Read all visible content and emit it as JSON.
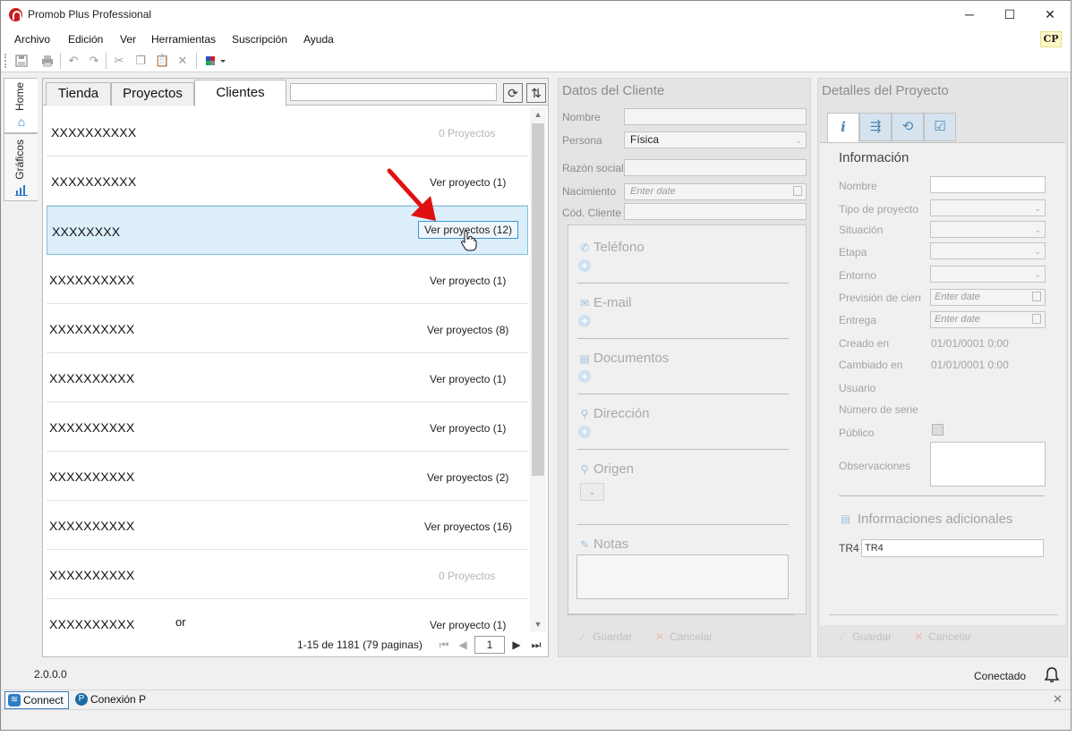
{
  "window": {
    "title": "Promob Plus Professional",
    "minimize": "─",
    "maximize": "☐",
    "close": "✕"
  },
  "menu": {
    "items": [
      "Archivo",
      "Edición",
      "Ver",
      "Herramientas",
      "Suscripción",
      "Ayuda"
    ],
    "badge": "CP"
  },
  "toolbar": {
    "icons": [
      "save-icon",
      "print-icon",
      "undo-icon",
      "redo-icon",
      "cut-icon",
      "copy-icon",
      "paste-icon",
      "delete-icon",
      "color-palette-icon"
    ]
  },
  "side_tabs": [
    {
      "label": "Home",
      "icon": "home-icon"
    },
    {
      "label": "Gráficos",
      "icon": "bar-chart-icon"
    }
  ],
  "list_panel": {
    "tabs": [
      "Tienda",
      "Proyectos",
      "Clientes"
    ],
    "active_tab": "Clientes",
    "search_value": "",
    "rows": [
      {
        "name": "XXXXXXXXXX",
        "link": "0 Proyectos",
        "zero": true
      },
      {
        "name": "XXXXXXXXXX",
        "link": "Ver proyecto (1)",
        "zero": false
      },
      {
        "name": "XXXXXXXX",
        "link": "Ver proyectos (12)",
        "zero": false,
        "selected": true
      },
      {
        "name": "XXXXXXXXXX",
        "link": "Ver proyecto (1)",
        "zero": false
      },
      {
        "name": "XXXXXXXXXX",
        "link": "Ver proyectos (8)",
        "zero": false
      },
      {
        "name": "XXXXXXXXXX",
        "link": "Ver proyecto (1)",
        "zero": false
      },
      {
        "name": "XXXXXXXXXX",
        "link": "Ver proyecto (1)",
        "zero": false
      },
      {
        "name": "XXXXXXXXXX",
        "link": "Ver proyectos (2)",
        "zero": false
      },
      {
        "name": "XXXXXXXXXX",
        "link": "Ver proyectos (16)",
        "zero": false
      },
      {
        "name": "XXXXXXXXXX",
        "link": "0 Proyectos",
        "zero": true
      },
      {
        "name": "XXXXXXXXXX",
        "extra": "or",
        "link": "Ver proyecto (1)",
        "zero": false
      }
    ],
    "pager": {
      "summary": "1-15 de 1181 (79 paginas)",
      "page": "1"
    }
  },
  "client_panel": {
    "title": "Datos del Cliente",
    "fields": {
      "nombre_label": "Nombre",
      "nombre_value": "",
      "persona_label": "Persona",
      "persona_value": "Física",
      "razon_label": "Razón social",
      "razon_value": "",
      "nacimiento_label": "Nacimiento",
      "nacimiento_placeholder": "Enter date",
      "codigo_label": "Cód. Cliente",
      "codigo_value": ""
    },
    "sections": [
      "Teléfono",
      "E-mail",
      "Documentos",
      "Dirección",
      "Origen",
      "Notas"
    ],
    "save": "Guardar",
    "cancel": "Cancelar"
  },
  "project_panel": {
    "title": "Detalles del Proyecto",
    "tabs": [
      "info-icon",
      "flow-icon",
      "history-icon",
      "checklist-icon"
    ],
    "info_title": "Información",
    "labels": {
      "nombre": "Nombre",
      "tipo": "Tipo de proyecto",
      "situacion": "Situación",
      "etapa": "Etapa",
      "entorno": "Entorno",
      "prevision": "Previsión de cierre",
      "entrega": "Entrega",
      "creado": "Creado en",
      "cambiado": "Cambiado en",
      "usuario": "Usuario",
      "serie": "Número de serie",
      "publico": "Público",
      "observaciones": "Observaciones"
    },
    "values": {
      "prevision_placeholder": "Enter date",
      "entrega_placeholder": "Enter date",
      "creado": "01/01/0001 0:00",
      "cambiado": "01/01/0001 0:00"
    },
    "additional_title": "Informaciones adicionales",
    "tr4_label": "TR4",
    "tr4_value": "TR4",
    "save": "Guardar",
    "cancel": "Cancelar"
  },
  "status": {
    "version": "2.0.0.0",
    "connection": "Conectado"
  },
  "bottom_tabs": [
    "Connect",
    "Conexión P"
  ],
  "colors": {
    "accent": "#2e7bc4",
    "selection": "#dbeefa",
    "annotation_red": "#e01010"
  }
}
